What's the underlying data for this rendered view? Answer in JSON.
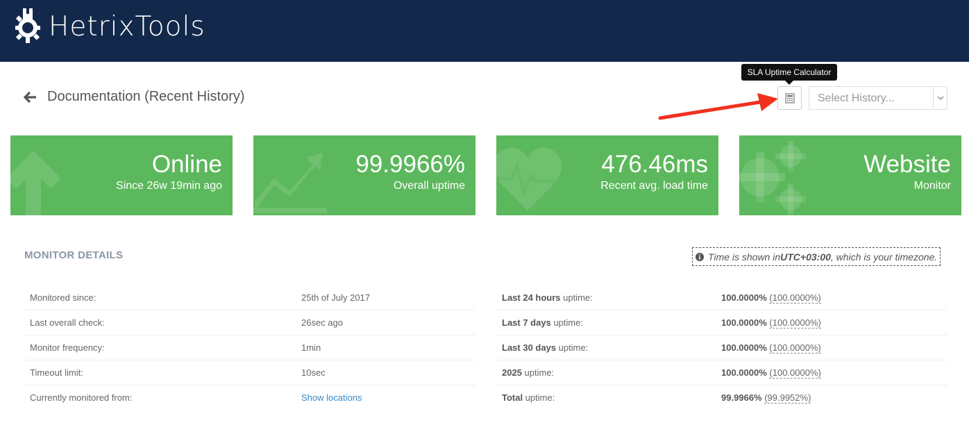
{
  "app": {
    "logo_text": "HetrixTools"
  },
  "header": {
    "title": "Documentation (Recent History)"
  },
  "toolbar": {
    "tooltip": "SLA Uptime Calculator",
    "history_placeholder": "Select History..."
  },
  "cards": [
    {
      "big": "Online",
      "small": "Since 26w 19min ago",
      "icon": "arrow-up-icon"
    },
    {
      "big": "99.9966%",
      "small": "Overall uptime",
      "icon": "trend-chart-icon"
    },
    {
      "big": "476.46ms",
      "small": "Recent avg. load time",
      "icon": "heartbeat-icon"
    },
    {
      "big": "Website",
      "small": "Monitor",
      "icon": "gears-icon"
    }
  ],
  "colors": {
    "topbar": "#13294b",
    "card": "#5cb85c",
    "link": "#3a87c8",
    "arrow": "#f0311e"
  },
  "details": {
    "title": "MONITOR DETAILS",
    "tz_prefix": "Time is shown in ",
    "tz_value": "UTC+03:00",
    "tz_suffix": ", which is your timezone.",
    "left": [
      {
        "label": "Monitored since:",
        "value": "25th of July 2017"
      },
      {
        "label": "Last overall check:",
        "value": "26sec ago"
      },
      {
        "label": "Monitor frequency:",
        "value": "1min"
      },
      {
        "label": "Timeout limit:",
        "value": "10sec"
      },
      {
        "label": "Currently monitored from:",
        "value": "Show locations"
      }
    ],
    "right": [
      {
        "label_bold": "Last 24 hours",
        "label_rest": " uptime:",
        "value": "100.0000%",
        "alt": "(100.0000%)"
      },
      {
        "label_bold": "Last 7 days",
        "label_rest": " uptime:",
        "value": "100.0000%",
        "alt": "(100.0000%)"
      },
      {
        "label_bold": "Last 30 days",
        "label_rest": " uptime:",
        "value": "100.0000%",
        "alt": "(100.0000%)"
      },
      {
        "label_bold": "2025",
        "label_rest": " uptime:",
        "value": "100.0000%",
        "alt": "(100.0000%)"
      },
      {
        "label_bold": "Total",
        "label_rest": " uptime:",
        "value": "99.9966%",
        "alt": "(99.9952%)"
      }
    ]
  }
}
